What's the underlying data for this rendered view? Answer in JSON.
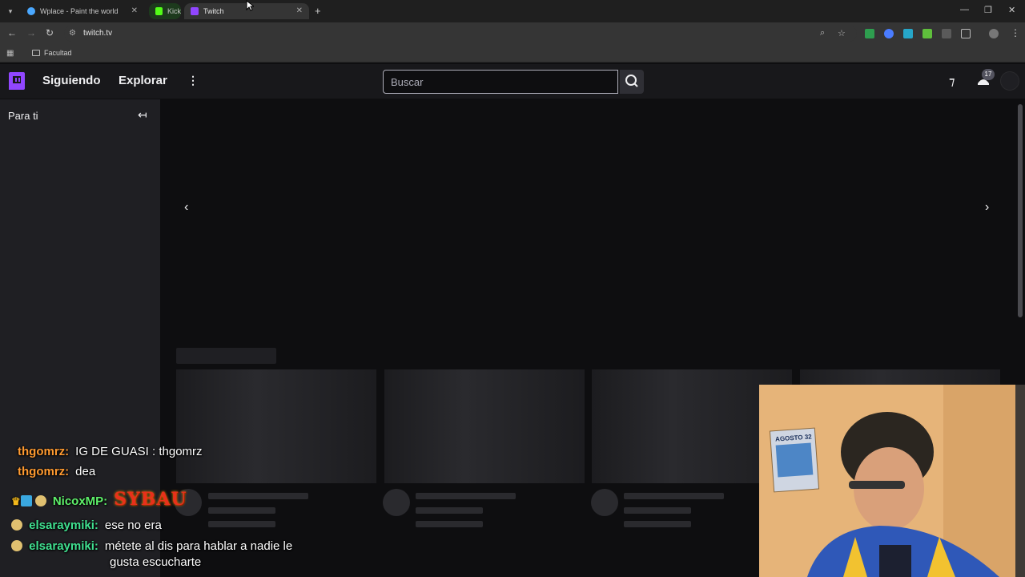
{
  "browser": {
    "tabs": [
      {
        "title": "Wplace - Paint the world",
        "favicon_color": "#4aa8ff"
      },
      {
        "title": "Kick",
        "favicon_color": "#53fc18"
      },
      {
        "title": "Twitch",
        "favicon_color": "#9146ff"
      }
    ],
    "new_tab": "+",
    "url": "twitch.tv",
    "bookmark_folder": "Facultad"
  },
  "twitch": {
    "nav": {
      "following": "Siguiendo",
      "explore": "Explorar",
      "more": "⋮"
    },
    "search": {
      "placeholder": "Buscar"
    },
    "notifications_count": "17",
    "sidebar": {
      "title": "Para ti",
      "collapse": "↤"
    }
  },
  "chat": [
    {
      "user": "thgomrz:",
      "user_color": "#ff9a30",
      "message": "IG DE GUASI : thgomrz"
    },
    {
      "user": "thgomrz:",
      "user_color": "#ff9a30",
      "message": "dea"
    },
    {
      "user": "NicoxMP:",
      "user_color": "#5ef06a",
      "message": "SYBAU"
    },
    {
      "user": "elsaraymiki:",
      "user_color": "#40e090",
      "message": "ese no era"
    },
    {
      "user": "elsaraymiki:",
      "user_color": "#40e090",
      "message": "métete al dis para hablar a nadie le"
    },
    {
      "user": "",
      "user_color": "#40e090",
      "message": "gusta escucharte"
    }
  ],
  "webcam": {
    "poster_text": "AGOSTO 32"
  }
}
